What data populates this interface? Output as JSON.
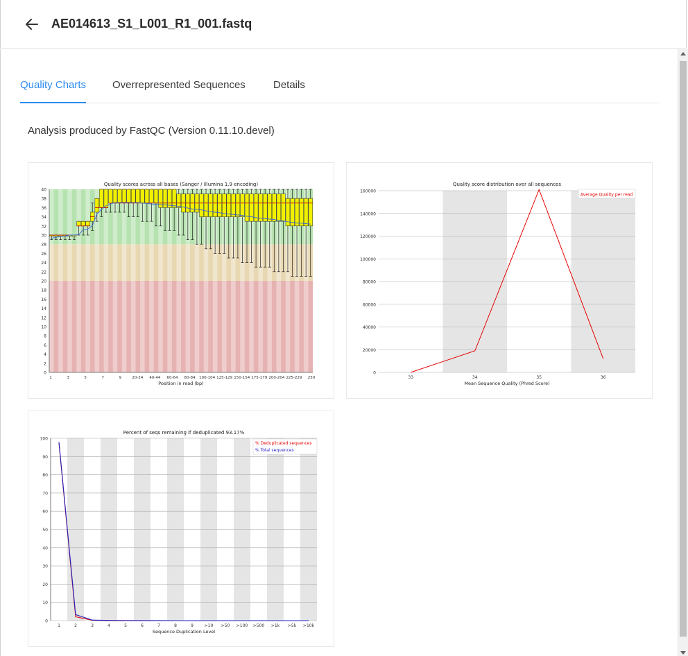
{
  "header": {
    "title": "AE014613_S1_L001_R1_001.fastq",
    "back_icon": "arrow-left-icon"
  },
  "tabs": [
    {
      "label": "Quality Charts",
      "active": true
    },
    {
      "label": "Overrepresented Sequences",
      "active": false
    },
    {
      "label": "Details",
      "active": false
    }
  ],
  "analysis_text": "Analysis produced by FastQC (Version 0.11.10.devel)",
  "colors": {
    "accent": "#2d8cf0"
  },
  "chart_data": [
    {
      "type": "box",
      "title": "Quality scores across all bases (Sanger / Illumina 1.9 encoding)",
      "xlabel": "Position in read (bp)",
      "ylabel": "",
      "ylim": [
        0,
        40
      ],
      "yticks": [
        0,
        2,
        4,
        6,
        8,
        10,
        12,
        14,
        16,
        18,
        20,
        22,
        24,
        26,
        28,
        30,
        32,
        34,
        36,
        38,
        40
      ],
      "xticks": [
        "1",
        "3",
        "5",
        "7",
        "9",
        "20-24",
        "40-44",
        "60-64",
        "80-84",
        "100-104",
        "125-129",
        "150-154",
        "175-179",
        "200-204",
        "225-229",
        "250"
      ],
      "bands": [
        {
          "from": 0,
          "to": 20,
          "color": "#e6b2b2"
        },
        {
          "from": 20,
          "to": 28,
          "color": "#e8d8b2"
        },
        {
          "from": 28,
          "to": 40,
          "color": "#b6e2b0"
        }
      ],
      "categories": [
        "1",
        "2",
        "3",
        "4",
        "5",
        "6",
        "7",
        "8",
        "9",
        "10-14",
        "15-19",
        "20-24",
        "25-29",
        "30-34",
        "35-39",
        "40-44",
        "45-49",
        "50-54",
        "55-59",
        "60-64",
        "65-69",
        "70-74",
        "75-79",
        "80-84",
        "85-89",
        "90-94",
        "95-99",
        "100-104",
        "105-109",
        "110-114",
        "115-119",
        "120-124",
        "125-129",
        "130-134",
        "135-139",
        "140-144",
        "145-149",
        "150-154",
        "155-159",
        "160-164",
        "165-169",
        "170-174",
        "175-179",
        "180-184",
        "185-189",
        "190-194",
        "195-199",
        "200-204",
        "205-209",
        "210-214",
        "215-219",
        "220-224",
        "225-229",
        "230-234",
        "235-239",
        "240-244",
        "245-249",
        "250"
      ],
      "mean": [
        29.3,
        29.5,
        29.7,
        29.8,
        30.0,
        30.0,
        30.1,
        31.2,
        31.3,
        32.1,
        34.6,
        35.6,
        36.4,
        36.8,
        37.1,
        37.1,
        37.2,
        37.2,
        37.1,
        37.1,
        37.0,
        36.9,
        36.8,
        36.7,
        36.7,
        36.6,
        36.5,
        36.4,
        36.3,
        36.1,
        35.9,
        35.7,
        35.6,
        35.5,
        35.3,
        35.1,
        35.0,
        34.9,
        34.7,
        34.6,
        34.5,
        34.4,
        34.3,
        34.1,
        34.0,
        33.8,
        33.7,
        33.6,
        33.5,
        33.4,
        33.2,
        33.1,
        32.9,
        32.8,
        32.6,
        32.6,
        32.5,
        32.4
      ],
      "median": [
        30,
        30,
        30,
        30,
        30,
        30,
        32,
        32,
        32,
        34,
        36,
        36,
        36,
        37,
        37,
        37,
        37,
        37,
        37,
        37,
        37,
        37,
        37,
        37,
        37,
        37,
        37,
        37,
        37,
        37,
        37,
        37,
        37,
        37,
        37,
        37,
        37,
        37,
        37,
        37,
        37,
        37,
        37,
        37,
        37,
        37,
        37,
        37,
        37,
        37,
        37,
        37,
        37,
        37,
        37,
        37,
        37,
        37
      ],
      "q1": [
        30,
        30,
        30,
        30,
        30,
        30,
        32,
        32,
        32,
        33,
        35,
        36,
        36,
        37,
        37,
        37,
        37,
        37,
        37,
        37,
        37,
        37,
        37,
        37,
        36,
        36,
        36,
        36,
        36,
        35,
        35,
        35,
        35,
        34,
        34,
        34,
        34,
        34,
        34,
        34,
        34,
        34,
        34,
        33,
        33,
        33,
        33,
        33,
        33,
        33,
        33,
        33,
        32,
        32,
        32,
        32,
        32,
        32
      ],
      "q3": [
        30,
        30,
        30,
        30,
        30,
        30,
        33,
        33,
        33,
        35,
        38,
        40,
        40,
        40,
        40,
        40,
        40,
        40,
        40,
        40,
        40,
        40,
        40,
        40,
        40,
        40,
        40,
        40,
        39,
        39,
        39,
        39,
        39,
        39,
        39,
        39,
        39,
        39,
        39,
        39,
        39,
        39,
        39,
        39,
        39,
        39,
        39,
        39,
        39,
        39,
        39,
        39,
        38,
        38,
        38,
        38,
        38,
        38
      ],
      "p10": [
        29,
        29,
        29,
        29,
        29,
        29,
        30,
        30,
        30,
        31,
        33,
        34,
        35,
        35,
        35,
        35,
        35,
        34,
        34,
        34,
        33,
        33,
        33,
        32,
        32,
        31,
        31,
        31,
        30,
        30,
        29,
        29,
        28,
        28,
        27,
        27,
        26,
        26,
        26,
        25,
        25,
        25,
        24,
        24,
        24,
        23,
        23,
        23,
        23,
        22,
        22,
        22,
        22,
        21,
        21,
        21,
        21,
        21
      ],
      "p90": [
        30,
        30,
        30,
        30,
        30,
        30,
        33,
        33,
        33,
        37,
        38,
        40,
        40,
        40,
        40,
        40,
        40,
        40,
        40,
        40,
        40,
        40,
        40,
        40,
        40,
        40,
        40,
        40,
        40,
        40,
        40,
        40,
        40,
        40,
        40,
        40,
        40,
        40,
        40,
        40,
        40,
        40,
        40,
        40,
        40,
        40,
        40,
        40,
        40,
        40,
        40,
        40,
        40,
        40,
        40,
        40,
        40,
        40
      ]
    },
    {
      "type": "line",
      "title": "Quality score distribution over all sequences",
      "xlabel": "Mean Sequence Quality (Phred Score)",
      "ylabel": "",
      "x": [
        33,
        34,
        35,
        36
      ],
      "ylim": [
        0,
        160000
      ],
      "yticks": [
        0,
        20000,
        40000,
        60000,
        80000,
        100000,
        120000,
        140000,
        160000
      ],
      "series": [
        {
          "name": "Average Quality per read",
          "color": "#e60000",
          "values": [
            0,
            19000,
            161000,
            12000
          ]
        }
      ],
      "legend": "top-right",
      "grid": true
    },
    {
      "type": "line",
      "title": "Percent of seqs remaining if deduplicated 93.17%",
      "xlabel": "Sequence Duplication Level",
      "ylabel": "",
      "categories": [
        "1",
        "2",
        "3",
        "4",
        "5",
        "6",
        "7",
        "8",
        "9",
        ">10",
        ">50",
        ">100",
        ">500",
        ">1k",
        ">5k",
        ">10k"
      ],
      "ylim": [
        0,
        100
      ],
      "yticks": [
        0,
        10,
        20,
        30,
        40,
        50,
        60,
        70,
        80,
        90,
        100
      ],
      "series": [
        {
          "name": "% Deduplicated sequences",
          "color": "#e60000",
          "values": [
            97.5,
            2.1,
            0.2,
            0.05,
            0.02,
            0.01,
            0.0,
            0.0,
            0.0,
            0.0,
            0.0,
            0.0,
            0.0,
            0.0,
            0.0,
            0.0
          ]
        },
        {
          "name": "% Total sequences",
          "color": "#1f1fbf",
          "values": [
            97.9,
            3.3,
            0.3,
            0.1,
            0.05,
            0.02,
            0.01,
            0.0,
            0.0,
            0.0,
            0.0,
            0.0,
            0.0,
            0.0,
            0.0,
            0.0
          ]
        }
      ],
      "legend": "top-right",
      "grid": true
    }
  ]
}
